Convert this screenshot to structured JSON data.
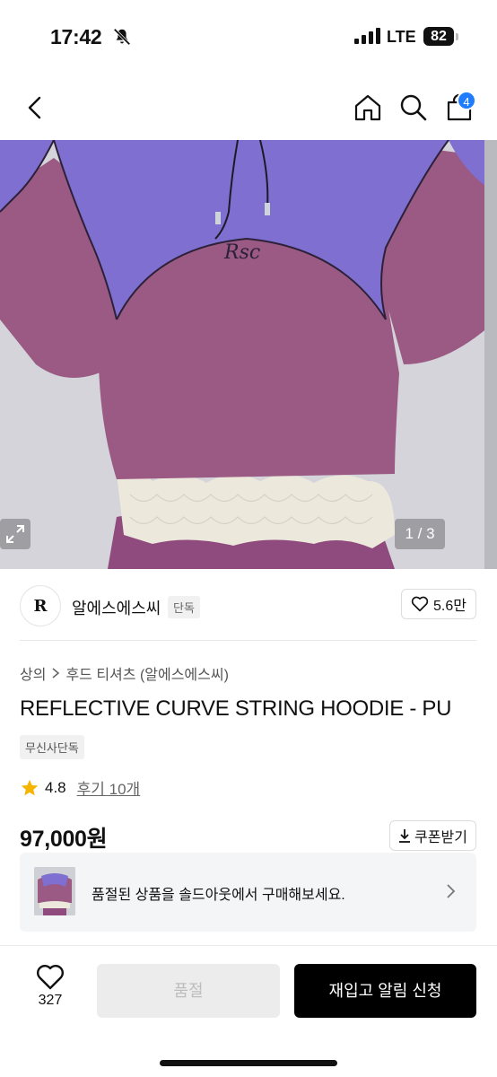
{
  "status_bar": {
    "time": "17:42",
    "network": "LTE",
    "battery": "82",
    "icons": [
      "mute-bell-icon",
      "signal-bars-icon",
      "battery-icon"
    ]
  },
  "nav": {
    "icons": [
      "back-chevron-icon",
      "home-icon",
      "search-icon",
      "cart-icon"
    ],
    "cart_count": "4"
  },
  "gallery": {
    "pager": "1 / 3",
    "colors": {
      "lavender": "#7f6fd0",
      "mauve": "#9a5a84",
      "lace": "#ece8dc",
      "background": "#d9d9de"
    }
  },
  "brand": {
    "logo_text": "R",
    "name": "알에스에스씨",
    "tag": "단독",
    "likes": "5.6만"
  },
  "product": {
    "breadcrumb": [
      "상의",
      "후드 티셔츠 (알에스에스씨)"
    ],
    "title": "REFLECTIVE CURVE STRING HOODIE - PU",
    "exclusive_tag": "무신사단독",
    "rating": "4.8",
    "reviews": "후기 10개",
    "price": "97,000원",
    "coupon_label": "쿠폰받기"
  },
  "soldout_banner": {
    "text": "품절된 상품을 솔드아웃에서 구매해보세요."
  },
  "bottom_bar": {
    "wish_count": "327",
    "soldout_label": "품절",
    "restock_label": "재입고 알림 신청"
  }
}
